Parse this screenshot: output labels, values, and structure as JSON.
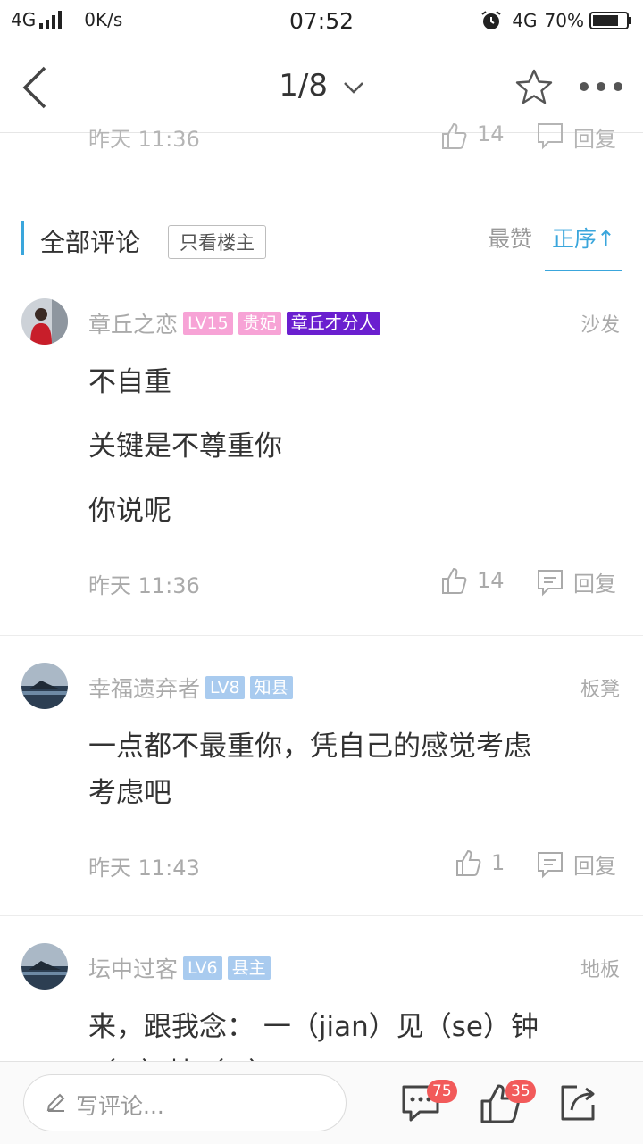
{
  "status_bar": {
    "network": "4G",
    "speed": "0K/s",
    "time": "07:52",
    "network2": "4G",
    "battery": "70%"
  },
  "nav": {
    "page_indicator": "1/8"
  },
  "clipped_row": {
    "time": "昨天 11:36",
    "likes": "14",
    "reply": "回复"
  },
  "section": {
    "title": "全部评论",
    "owner_only": "只看楼主",
    "sort_best": "最赞",
    "sort_asc": "正序↑"
  },
  "comments": [
    {
      "username": "章丘之恋",
      "badges": [
        {
          "text": "LV15",
          "color": "#f7a3d6"
        },
        {
          "text": "贵妃",
          "color": "#f7a3d6"
        },
        {
          "text": "章丘才分人",
          "color": "#6a1fcf"
        }
      ],
      "floor": "沙发",
      "lines": [
        "不自重",
        "关键是不尊重你",
        "你说呢"
      ],
      "time": "昨天 11:36",
      "likes": "14",
      "reply": "回复"
    },
    {
      "username": "幸福遗弃者",
      "badges": [
        {
          "text": "LV8",
          "color": "#a9cbef"
        },
        {
          "text": "知县",
          "color": "#a9cbef"
        }
      ],
      "floor": "板凳",
      "lines": [
        "一点都不最重你，凭自己的感觉考虑",
        "考虑吧"
      ],
      "time": "昨天 11:43",
      "likes": "1",
      "reply": "回复"
    },
    {
      "username": "坛中过客",
      "badges": [
        {
          "text": "LV6",
          "color": "#a9cbef"
        },
        {
          "text": "县主",
          "color": "#a9cbef"
        }
      ],
      "floor": "地板",
      "lines": [
        "来，跟我念： 一（jian）见（se）钟",
        "（qi）情（yi）"
      ]
    }
  ],
  "bottom_bar": {
    "placeholder": "写评论...",
    "comment_count": "75",
    "like_count": "35"
  },
  "colors": {
    "accent": "#3aa6dc",
    "badge_red": "#f25a5a"
  }
}
